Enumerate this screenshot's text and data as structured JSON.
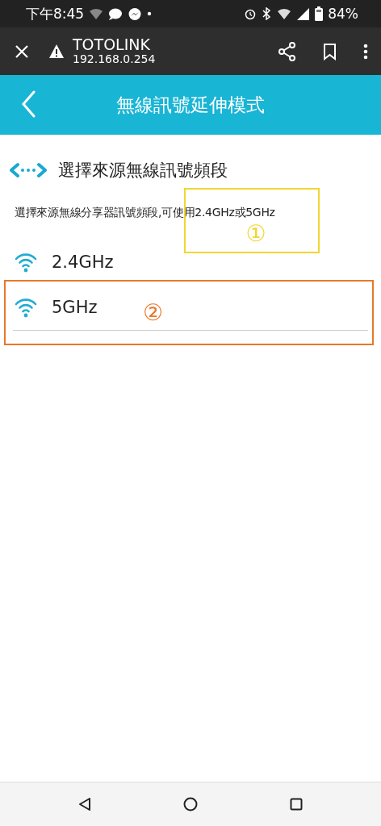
{
  "status_bar": {
    "time": "下午8:45",
    "battery": "84%"
  },
  "browser_bar": {
    "site_title": "TOTOLINK",
    "url": "192.168.0.254"
  },
  "header": {
    "title": "無線訊號延伸模式"
  },
  "section": {
    "title": "選擇來源無線訊號頻段",
    "description": "選擇來源無線分享器訊號頻段,可使用2.4GHz或5GHz"
  },
  "bands": [
    {
      "label": "2.4GHz",
      "divider": false
    },
    {
      "label": "5GHz",
      "divider": true
    }
  ],
  "annotations": [
    {
      "number": "①",
      "color": "#f2d630"
    },
    {
      "number": "②",
      "color": "#e8782a"
    }
  ]
}
